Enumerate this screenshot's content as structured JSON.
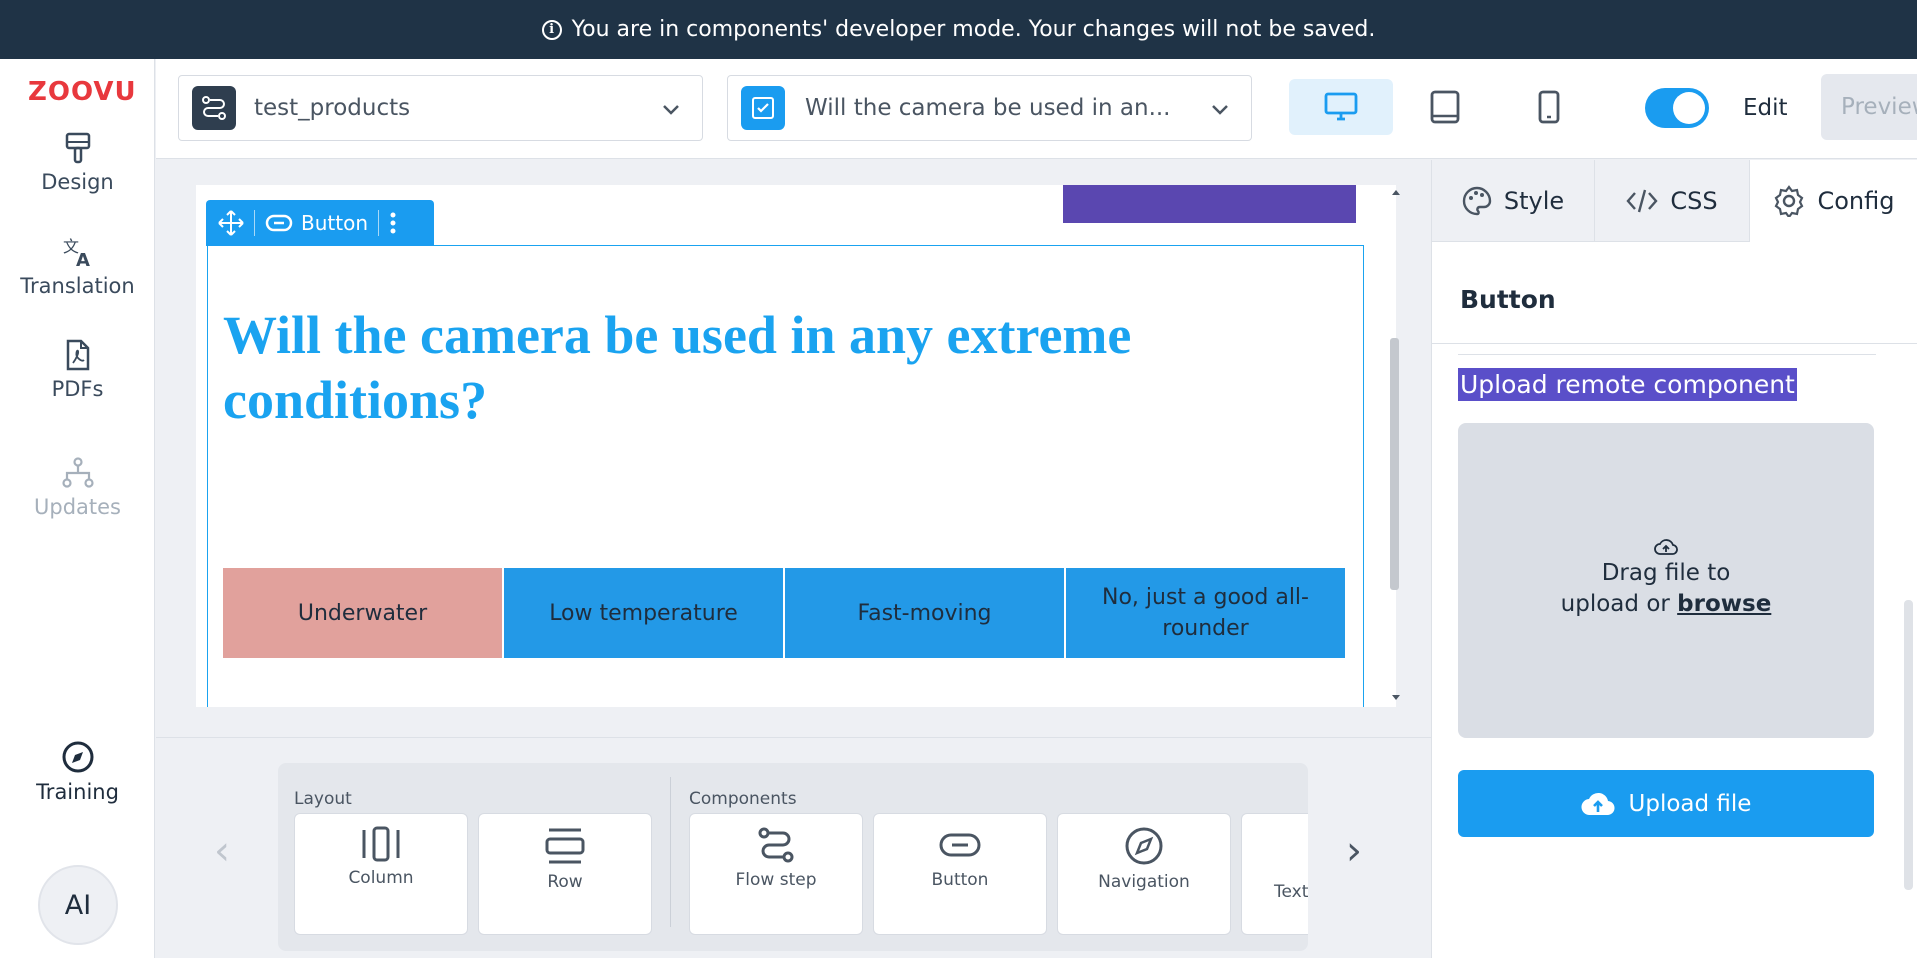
{
  "banner": {
    "text": "You are in components' developer mode. Your changes will not be saved."
  },
  "logo": {
    "text": "ZOOVU"
  },
  "leftnav": {
    "design": "Design",
    "translation": "Translation",
    "pdfs": "PDFs",
    "updates": "Updates",
    "training": "Training",
    "ai": "AI"
  },
  "topbar": {
    "flow_select": "test_products",
    "question_select": "Will the camera be used in an...",
    "edit_label": "Edit",
    "preview_label": "Preview",
    "edit_mode_on": true
  },
  "canvas": {
    "toolbar_label": "Button",
    "question": "Will the camera be used in any extreme conditions?",
    "answers": [
      "Underwater",
      "Low temperature",
      "Fast-moving",
      "No, just a good all-rounder"
    ]
  },
  "palette": {
    "layout_label": "Layout",
    "components_label": "Components",
    "items": [
      "Column",
      "Row",
      "Flow step",
      "Button",
      "Navigation",
      "Text"
    ]
  },
  "panel": {
    "tab_style": "Style",
    "tab_css": "CSS",
    "tab_config": "Config",
    "title": "Button",
    "upload_label": "Upload remote component",
    "drop_line1": "Drag file to",
    "drop_line2": "upload or",
    "drop_browse": "browse",
    "upload_button": "Upload file"
  },
  "colors": {
    "banner": "#1f3346",
    "accent": "#1a9cf0",
    "question": "#1aa3f0",
    "answer": "#2399e7",
    "answer_selected": "#e1a19c",
    "highlight": "#5a4fc9"
  }
}
